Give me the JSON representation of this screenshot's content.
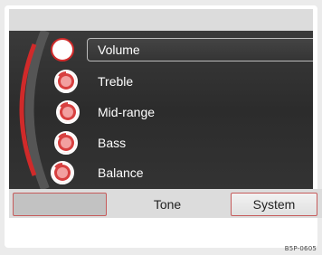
{
  "menu": {
    "items": [
      {
        "label": "Volume",
        "selected": true,
        "icon": "knob-icon-selected"
      },
      {
        "label": "Treble",
        "selected": false,
        "icon": "knob-icon"
      },
      {
        "label": "Mid-range",
        "selected": false,
        "icon": "knob-icon"
      },
      {
        "label": "Bass",
        "selected": false,
        "icon": "knob-icon"
      },
      {
        "label": "Balance",
        "selected": false,
        "icon": "knob-icon"
      }
    ]
  },
  "softkeys": {
    "left_label": "",
    "center_label": "Tone",
    "right_label": "System"
  },
  "figure_code": "B5P-0605",
  "colors": {
    "accent_red": "#d02a2a",
    "panel_bg": "#333333",
    "bar_bg": "#dcdcdc"
  }
}
